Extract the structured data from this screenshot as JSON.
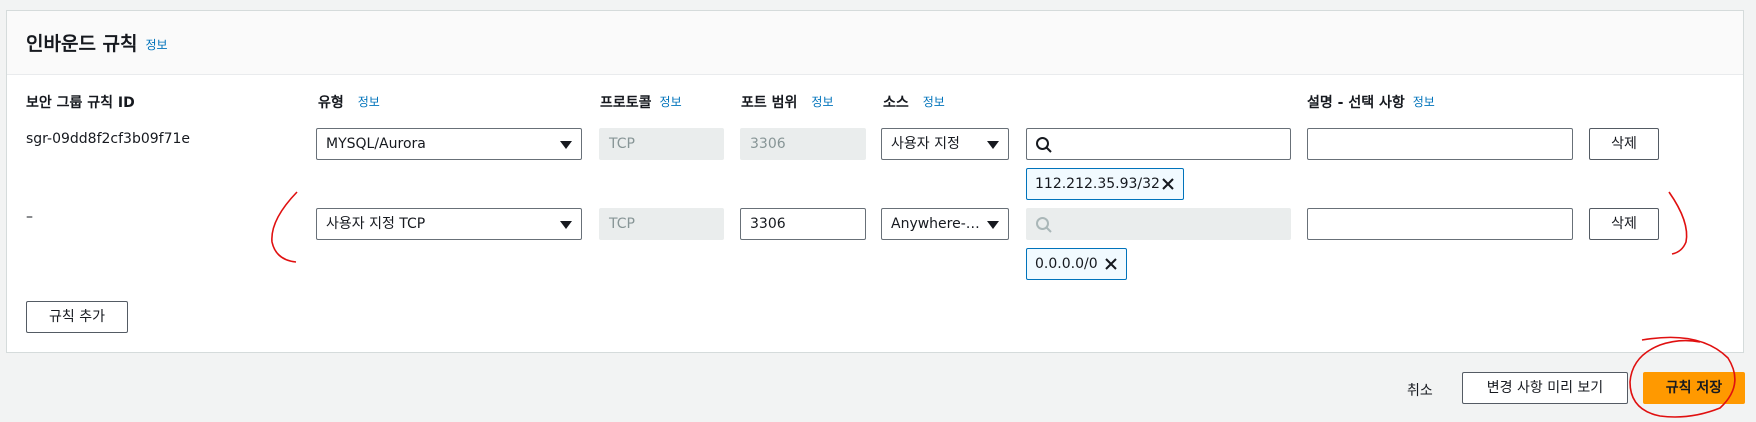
{
  "panel": {
    "title": "인바운드 규칙",
    "title_info": "정보"
  },
  "columns": {
    "rule_id": "보안 그룹 규칙 ID",
    "type": "유형",
    "type_info": "정보",
    "protocol": "프로토콜",
    "protocol_info": "정보",
    "port_range": "포트 범위",
    "port_range_info": "정보",
    "source": "소스",
    "source_info": "정보",
    "description": "설명 - 선택 사항",
    "description_info": "정보"
  },
  "rules": [
    {
      "rule_id": "sgr-09dd8f2cf3b09f71e",
      "type": "MYSQL/Aurora",
      "protocol": "TCP",
      "port_range": "3306",
      "source": "사용자 지정",
      "source_search": "",
      "token": "112.212.35.93/32",
      "description": "",
      "delete_label": "삭제"
    },
    {
      "rule_id": "–",
      "type": "사용자 지정 TCP",
      "protocol": "TCP",
      "port_range": "3306",
      "source": "Anywhere-…",
      "source_search": "",
      "token": "0.0.0.0/0",
      "description": "",
      "delete_label": "삭제"
    }
  ],
  "add_rule_label": "규칙 추가",
  "footer": {
    "cancel": "취소",
    "preview": "변경 사항 미리 보기",
    "save": "규칙 저장"
  },
  "colors": {
    "accent": "#ff9900",
    "link": "#0073bb",
    "annotation": "#e01010"
  },
  "icons": [
    "search-icon",
    "close-icon",
    "chevron-down-icon"
  ]
}
